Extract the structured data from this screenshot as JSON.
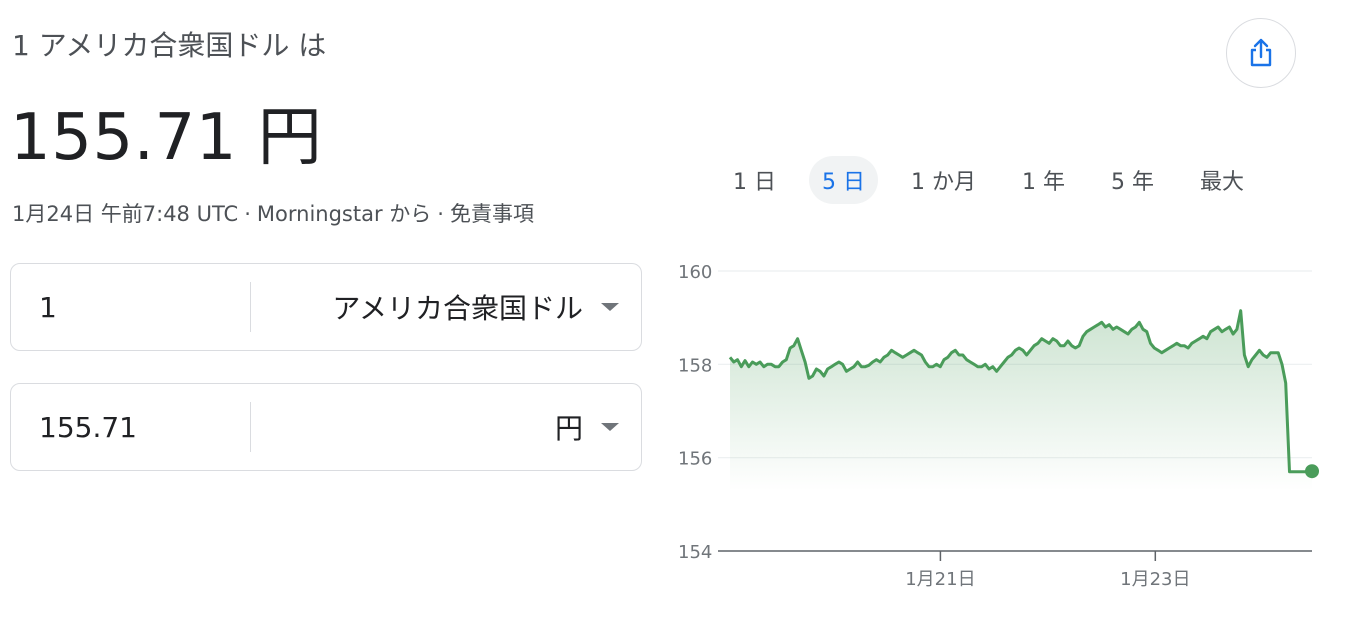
{
  "header": {
    "title": "1 アメリカ合衆国ドル は",
    "rate": "155.71 円"
  },
  "meta": {
    "date": "1月24日 午前7:48 UTC",
    "sep": "·",
    "source": "Morningstar から",
    "disclaimer": "免責事項"
  },
  "converter": {
    "from_amount": "1",
    "from_currency": "アメリカ合衆国ドル",
    "to_amount": "155.71",
    "to_currency": "円"
  },
  "tabs": [
    {
      "label": "1 日",
      "active": false
    },
    {
      "label": "5 日",
      "active": true
    },
    {
      "label": "1 か月",
      "active": false
    },
    {
      "label": "1 年",
      "active": false
    },
    {
      "label": "5 年",
      "active": false
    },
    {
      "label": "最大",
      "active": false
    }
  ],
  "colors": {
    "line": "#4a9c5a",
    "active_tab": "#1a73e8",
    "share_icon": "#1a73e8"
  },
  "icons": {
    "share": "share-icon",
    "dropdown": "caret-down-icon"
  },
  "chart_data": {
    "type": "area",
    "ylim": [
      154,
      160
    ],
    "xlim": [
      0,
      130
    ],
    "yticks": [
      154,
      156,
      158,
      160
    ],
    "xticks": [
      {
        "x": 47,
        "label": "1月21日"
      },
      {
        "x": 95,
        "label": "1月23日"
      }
    ],
    "grid": true,
    "values": [
      158.15,
      158.05,
      158.1,
      157.95,
      158.08,
      157.95,
      158.05,
      158.0,
      158.05,
      157.95,
      158.0,
      158.0,
      157.95,
      157.95,
      158.05,
      158.1,
      158.35,
      158.4,
      158.55,
      158.3,
      158.05,
      157.7,
      157.75,
      157.9,
      157.85,
      157.75,
      157.9,
      157.95,
      158.0,
      158.05,
      158.0,
      157.85,
      157.9,
      157.95,
      158.05,
      157.95,
      157.95,
      157.98,
      158.05,
      158.1,
      158.05,
      158.15,
      158.2,
      158.3,
      158.25,
      158.2,
      158.15,
      158.2,
      158.25,
      158.3,
      158.25,
      158.2,
      158.05,
      157.95,
      157.95,
      158.0,
      157.95,
      158.1,
      158.15,
      158.25,
      158.3,
      158.2,
      158.2,
      158.1,
      158.05,
      158.0,
      157.95,
      157.95,
      158.0,
      157.9,
      157.95,
      157.85,
      157.95,
      158.05,
      158.15,
      158.2,
      158.3,
      158.35,
      158.3,
      158.2,
      158.3,
      158.4,
      158.45,
      158.55,
      158.5,
      158.45,
      158.55,
      158.5,
      158.4,
      158.4,
      158.5,
      158.4,
      158.35,
      158.4,
      158.6,
      158.7,
      158.75,
      158.8,
      158.85,
      158.9,
      158.8,
      158.85,
      158.75,
      158.8,
      158.75,
      158.7,
      158.65,
      158.75,
      158.8,
      158.9,
      158.75,
      158.7,
      158.45,
      158.35,
      158.3,
      158.25,
      158.3,
      158.35,
      158.4,
      158.45,
      158.4,
      158.4,
      158.35,
      158.45,
      158.5,
      158.55,
      158.6,
      158.55,
      158.7,
      158.75,
      158.8,
      158.7,
      158.75,
      158.8,
      158.65,
      158.75,
      159.15,
      158.2,
      157.95,
      158.1,
      158.2,
      158.3,
      158.2,
      158.15,
      158.25,
      158.25,
      158.25,
      158.0,
      157.6,
      155.7,
      155.7,
      155.7,
      155.7,
      155.7,
      155.7,
      155.71
    ]
  }
}
